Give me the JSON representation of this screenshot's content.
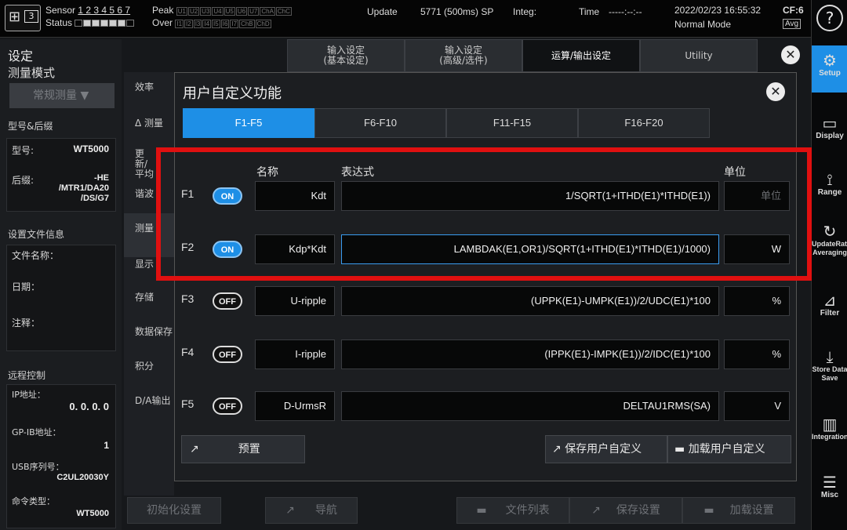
{
  "topbar": {
    "ch_num": "3",
    "sensor_label": "Sensor",
    "sensor_nums": "1 2 3 4 5 6 7",
    "status_label": "Status",
    "peak_label": "Peak",
    "over_label": "Over",
    "peak_chs": [
      "U1",
      "U2",
      "U3",
      "U4",
      "U5",
      "U6",
      "U7",
      "ChA",
      "ChC"
    ],
    "over_chs": [
      "I1",
      "I2",
      "I3",
      "I4",
      "I5",
      "I6",
      "I7",
      "ChB",
      "ChD"
    ],
    "update_label": "Update",
    "update_value": "5771 (500ms) SP",
    "integ_label": "Integ:",
    "time_label": "Time",
    "time_value": "-----:--:--",
    "datetime": "2022/02/23 16:55:32",
    "mode": "Normal Mode",
    "cf": "CF:6",
    "avg": "Avg",
    "help": "?"
  },
  "rightbar": [
    {
      "icon": "gear-icon",
      "glyph": "⚙",
      "label": "Setup"
    },
    {
      "icon": "display-icon",
      "glyph": "▭",
      "label": "Display"
    },
    {
      "icon": "range-icon",
      "glyph": "⟟",
      "label": "Range"
    },
    {
      "icon": "refresh-icon",
      "glyph": "↻",
      "label": "UpdateRate Averaging"
    },
    {
      "icon": "filter-icon",
      "glyph": "⊿",
      "label": "Filter"
    },
    {
      "icon": "store-icon",
      "glyph": "⤓",
      "label": "Store Data Save"
    },
    {
      "icon": "integration-icon",
      "glyph": "▥",
      "label": "Integration"
    },
    {
      "icon": "misc-icon",
      "glyph": "☰",
      "label": "Misc"
    }
  ],
  "left": {
    "title": "设定",
    "subtitle": "测量模式",
    "mode_btn": "常规测量",
    "model_section": "型号&后缀",
    "model_label": "型号:",
    "model_value": "WT5000",
    "suffix_label": "后缀:",
    "suffix_value": "-HE /MTR1/DA20 /DS/G7",
    "file_section": "设置文件信息",
    "file_name_label": "文件名称：",
    "date_label": "日期：",
    "note_label": "注释：",
    "remote_section": "远程控制",
    "ip_label": "IP地址：",
    "ip_value": "0. 0. 0. 0",
    "gpib_label": "GP-IB地址：",
    "gpib_value": "1",
    "usb_label": "USB序列号：",
    "usb_value": "C2UL20030Y",
    "cmd_label": "命令类型：",
    "cmd_value": "WT5000"
  },
  "menu": [
    "效率",
    "Δ 测量",
    "更新/平均",
    "谐波",
    "测量",
    "显示",
    "存储",
    "数据保存",
    "积分",
    "D/A输出"
  ],
  "tabs": [
    {
      "label": "输入设定\n(基本设定)"
    },
    {
      "label": "输入设定\n(高级/选件)"
    },
    {
      "label": "运算/输出设定"
    },
    {
      "label": "Utility"
    }
  ],
  "dialog": {
    "title": "用户自定义功能",
    "ftabs": [
      "F1-F5",
      "F6-F10",
      "F11-F15",
      "F16-F20"
    ],
    "col_name": "名称",
    "col_expr": "表达式",
    "col_unit": "单位",
    "rows": [
      {
        "id": "F1",
        "state": "ON",
        "name": "Kdt",
        "expr": "1/SQRT(1+ITHD(E1)*ITHD(E1))",
        "unit": "单位"
      },
      {
        "id": "F2",
        "state": "ON",
        "name": "Kdp*Kdt",
        "expr": "LAMBDAK(E1,OR1)/SQRT(1+ITHD(E1)*ITHD(E1)/1000)",
        "unit": "W"
      },
      {
        "id": "F3",
        "state": "OFF",
        "name": "U-ripple",
        "expr": "(UPPK(E1)-UMPK(E1))/2/UDC(E1)*100",
        "unit": "%"
      },
      {
        "id": "F4",
        "state": "OFF",
        "name": "I-ripple",
        "expr": "(IPPK(E1)-IMPK(E1))/2/IDC(E1)*100",
        "unit": "%"
      },
      {
        "id": "F5",
        "state": "OFF",
        "name": "D-UrmsR",
        "expr": "DELTAU1RMS(SA)",
        "unit": "V"
      }
    ],
    "preset": "预置",
    "save_user": "保存用户自定义",
    "load_user": "加载用户自定义"
  },
  "bottom": {
    "init": "初始化设置",
    "nav": "导航",
    "filelist": "文件列表",
    "save": "保存设置",
    "load": "加载设置"
  }
}
